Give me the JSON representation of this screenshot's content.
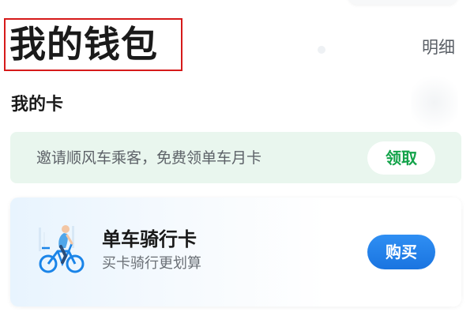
{
  "header": {
    "title": "我的钱包",
    "detail_label": "明细"
  },
  "cards_section": {
    "title": "我的卡"
  },
  "invite_banner": {
    "text": "邀请顺风车乘客，免费领单车月卡",
    "button_label": "领取",
    "accent_color": "#13a34a"
  },
  "bike_card": {
    "icon": "bike-rider-icon",
    "title": "单车骑行卡",
    "subtitle": "买卡骑行更划算",
    "button_label": "购买",
    "accent_color": "#1a74e0"
  }
}
